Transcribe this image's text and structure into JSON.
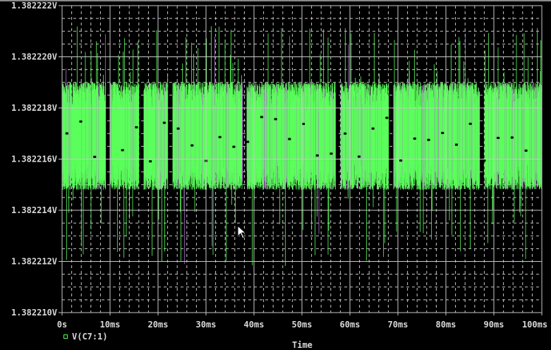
{
  "chart_data": {
    "type": "line",
    "title": "",
    "xlabel": "Time",
    "ylabel": "",
    "xlim": [
      0,
      100
    ],
    "ylim": [
      1.38221,
      1.382222
    ],
    "x_ticks": [
      "0s",
      "10ms",
      "20ms",
      "30ms",
      "40ms",
      "50ms",
      "60ms",
      "70ms",
      "80ms",
      "90ms",
      "100ms"
    ],
    "y_ticks": [
      "1.382222V",
      "1.382220V",
      "1.382218V",
      "1.382216V",
      "1.382214V",
      "1.382212V",
      "1.382210V"
    ],
    "y_tick_values": [
      1.382222,
      1.38222,
      1.382218,
      1.382216,
      1.382214,
      1.382212,
      1.38221
    ],
    "grid": true,
    "legend_position": "bottom-left",
    "series": [
      {
        "name": "V(C7:1)",
        "color": "#5cff5c",
        "mean": 1.3822168,
        "band_low": 1.3822148,
        "band_high": 1.382219,
        "min_spike": 1.3822118,
        "max_spike": 1.3822212,
        "gaps_ms": [
          9.5,
          16.5,
          22.5,
          38,
          57.5,
          68.5,
          87.5
        ]
      }
    ]
  },
  "legend": {
    "label": "V(C7:1)"
  },
  "colors": {
    "trace": "#5cff5c",
    "spike": "#b070d0",
    "grid": "#c8c8c8"
  }
}
